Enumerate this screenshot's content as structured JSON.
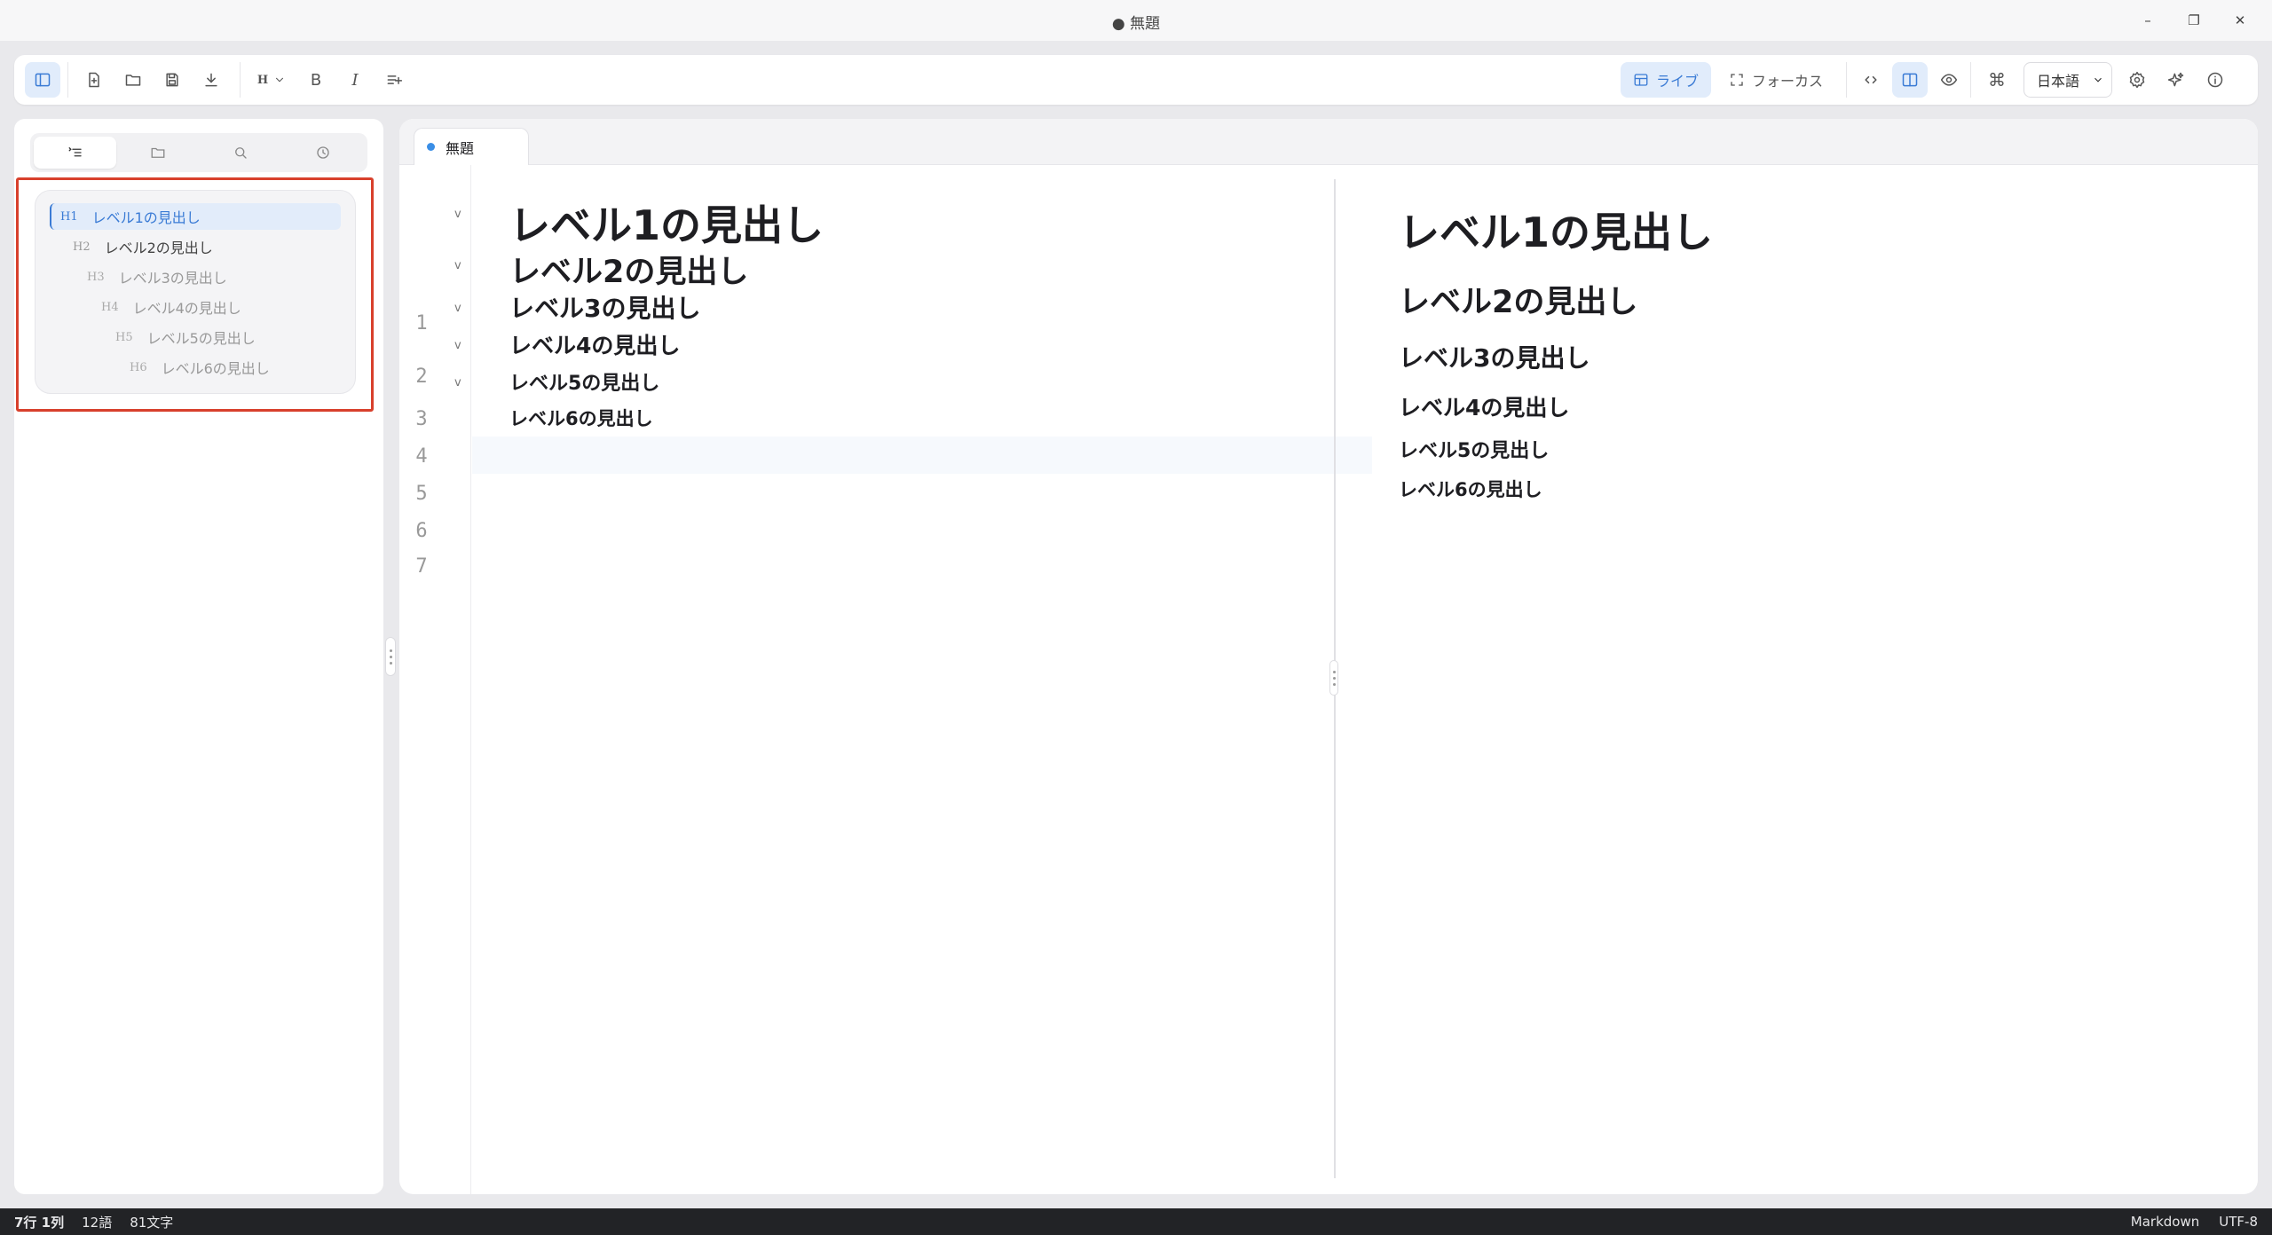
{
  "window": {
    "title": "● 無題",
    "minimize": "–",
    "maximize": "❐",
    "close": "✕"
  },
  "toolbar": {
    "heading_label": "H",
    "bold_label": "B",
    "italic_label": "I",
    "live_label": "ライブ",
    "focus_label": "フォーカス",
    "shortcut_glyph": "⌘",
    "language": "日本語"
  },
  "tabs": [
    {
      "label": "無題",
      "modified": true
    }
  ],
  "outline": [
    {
      "level": "H1",
      "text": "レベル1の見出し",
      "active": true
    },
    {
      "level": "H2",
      "text": "レベル2の見出し"
    },
    {
      "level": "H3",
      "text": "レベル3の見出し"
    },
    {
      "level": "H4",
      "text": "レベル4の見出し"
    },
    {
      "level": "H5",
      "text": "レベル5の見出し"
    },
    {
      "level": "H6",
      "text": "レベル6の見出し"
    }
  ],
  "editor": {
    "line_numbers": [
      "1",
      "2",
      "3",
      "4",
      "5",
      "6",
      "7"
    ],
    "fold_marker": "v",
    "lines": [
      "レベル1の見出し",
      "レベル2の見出し",
      "レベル3の見出し",
      "レベル4の見出し",
      "レベル5の見出し",
      "レベル6の見出し"
    ]
  },
  "preview": {
    "headings": [
      "レベル1の見出し",
      "レベル2の見出し",
      "レベル3の見出し",
      "レベル4の見出し",
      "レベル5の見出し",
      "レベル6の見出し"
    ]
  },
  "status": {
    "position": "7行 1列",
    "words": "12語",
    "chars": "81文字",
    "mode": "Markdown",
    "encoding": "UTF-8"
  },
  "colors": {
    "accent": "#3a7bd5",
    "highlight_frame": "#d8402c",
    "statusbar_bg": "#222326"
  }
}
